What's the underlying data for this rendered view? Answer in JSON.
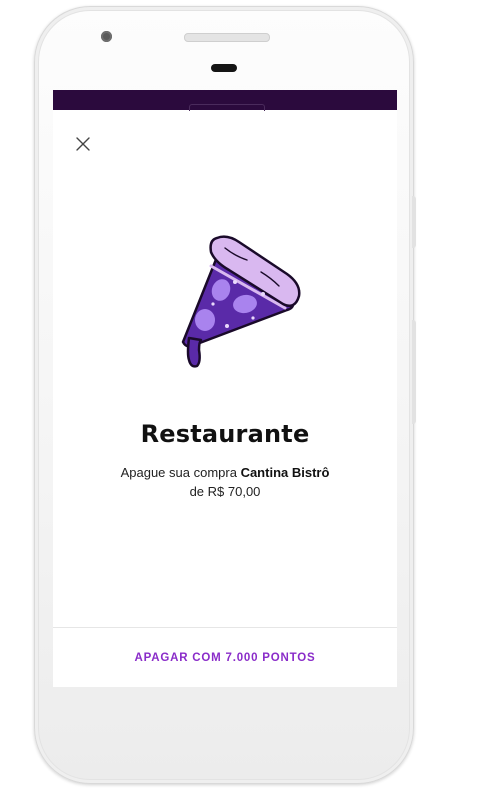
{
  "modal": {
    "close_icon": "close-icon",
    "illustration_icon": "pizza-slice-icon",
    "title": "Restaurante",
    "description_prefix": "Apague sua compra ",
    "merchant": "Cantina Bistrô",
    "amount_line": "de R$ 70,00"
  },
  "action": {
    "label": "APAGAR COM 7.000 PONTOS"
  },
  "colors": {
    "status_bar": "#2b0a3d",
    "accent": "#8a2cc9",
    "pizza_dark": "#5a2aa8",
    "pizza_light": "#d9b8f0"
  }
}
